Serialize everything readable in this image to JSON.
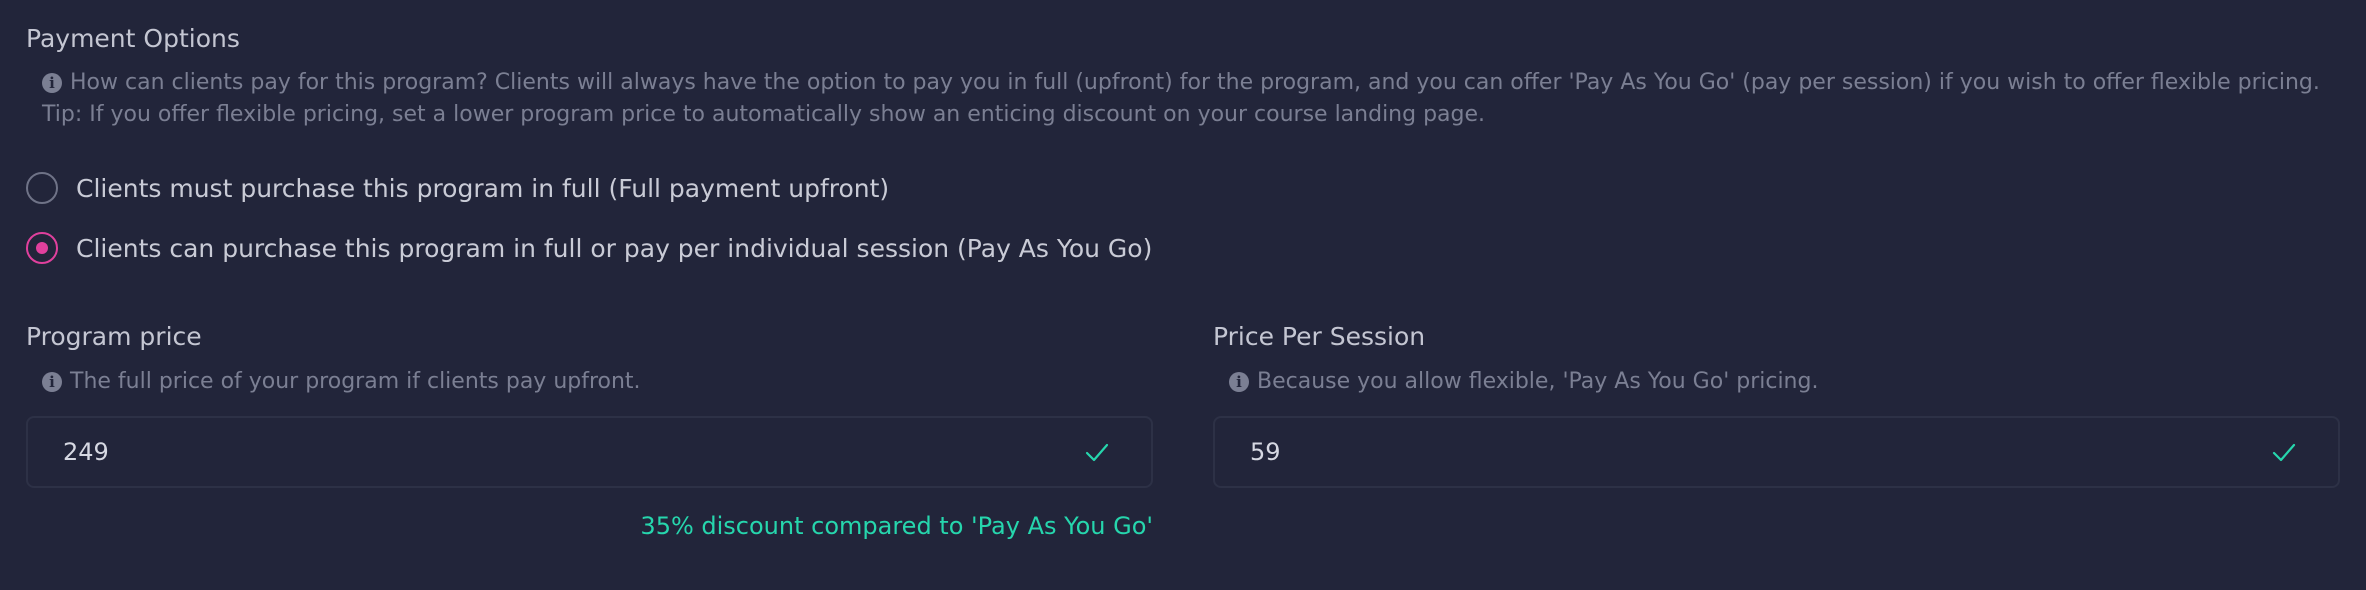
{
  "payment": {
    "title": "Payment Options",
    "help_line1": "How can clients pay for this program? Clients will always have the option to pay you in full (upfront) for the program, and you can offer 'Pay As You Go' (pay per session) if you wish to offer flexible pricing.",
    "help_line2": "Tip: If you offer flexible pricing, set a lower program price to automatically show an enticing discount on your course landing page.",
    "options": [
      {
        "label": "Clients must purchase this program in full (Full payment upfront)",
        "selected": false
      },
      {
        "label": "Clients can purchase this program in full or pay per individual session (Pay As You Go)",
        "selected": true
      }
    ]
  },
  "program_price": {
    "label": "Program price",
    "help": "The full price of your program if clients pay upfront.",
    "value": "249"
  },
  "price_per_session": {
    "label": "Price Per Session",
    "help": "Because you allow flexible, 'Pay As You Go' pricing.",
    "value": "59"
  },
  "discount_text": "35% discount compared to 'Pay As You Go'",
  "icons": {
    "info": "info-icon",
    "valid": "check-icon"
  },
  "colors": {
    "background": "#22253a",
    "accent_radio": "#e0409d",
    "success": "#26d6ad",
    "muted_text": "#7b7f93"
  }
}
